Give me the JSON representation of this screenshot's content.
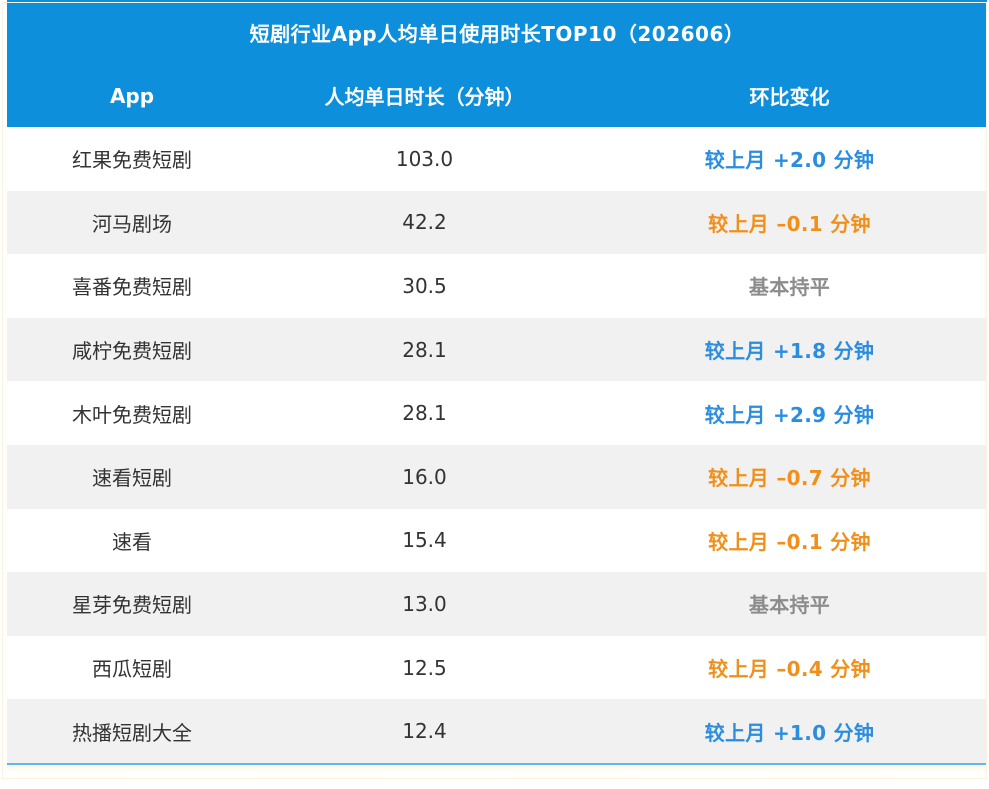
{
  "title": "短剧行业App人均单日使用时长TOP10（202606）",
  "headers": {
    "app": "App",
    "time": "人均单日时长（分钟）",
    "change": "环比变化"
  },
  "colors": {
    "header_bg": "#0d8fdc",
    "up": "#2a8de0",
    "down": "#f0901a",
    "flat": "#8c8c8c",
    "alt_row": "#f1f1f2"
  },
  "rows": [
    {
      "app": "红果免费短剧",
      "time": "103.0",
      "change": "较上月 +2.0 分钟",
      "trend": "up"
    },
    {
      "app": "河马剧场",
      "time": "42.2",
      "change": "较上月 –0.1 分钟",
      "trend": "down"
    },
    {
      "app": "喜番免费短剧",
      "time": "30.5",
      "change": "基本持平",
      "trend": "flat"
    },
    {
      "app": "咸柠免费短剧",
      "time": "28.1",
      "change": "较上月 +1.8 分钟",
      "trend": "up"
    },
    {
      "app": "木叶免费短剧",
      "time": "28.1",
      "change": "较上月 +2.9 分钟",
      "trend": "up"
    },
    {
      "app": "速看短剧",
      "time": "16.0",
      "change": "较上月 –0.7 分钟",
      "trend": "down"
    },
    {
      "app": "速看",
      "time": "15.4",
      "change": "较上月 –0.1 分钟",
      "trend": "down"
    },
    {
      "app": "星芽免费短剧",
      "time": "13.0",
      "change": "基本持平",
      "trend": "flat"
    },
    {
      "app": "西瓜短剧",
      "time": "12.5",
      "change": "较上月 –0.4 分钟",
      "trend": "down"
    },
    {
      "app": "热播短剧大全",
      "time": "12.4",
      "change": "较上月 +1.0 分钟",
      "trend": "up"
    }
  ]
}
